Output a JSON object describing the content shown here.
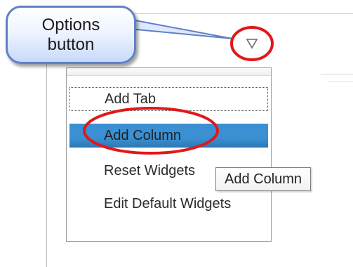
{
  "callout": {
    "line1": "Options",
    "line2": "button"
  },
  "menu": {
    "items": [
      {
        "label": "Add Tab"
      },
      {
        "label": "Add Column"
      },
      {
        "label": "Reset Widgets"
      },
      {
        "label": "Edit Default Widgets"
      }
    ]
  },
  "tooltip": {
    "text": "Add Column"
  },
  "icons": {
    "options": "chevron-down-icon"
  },
  "colors": {
    "highlight": "#3a90d2",
    "annotation": "#e01818",
    "callout_border": "#5f81c7"
  }
}
